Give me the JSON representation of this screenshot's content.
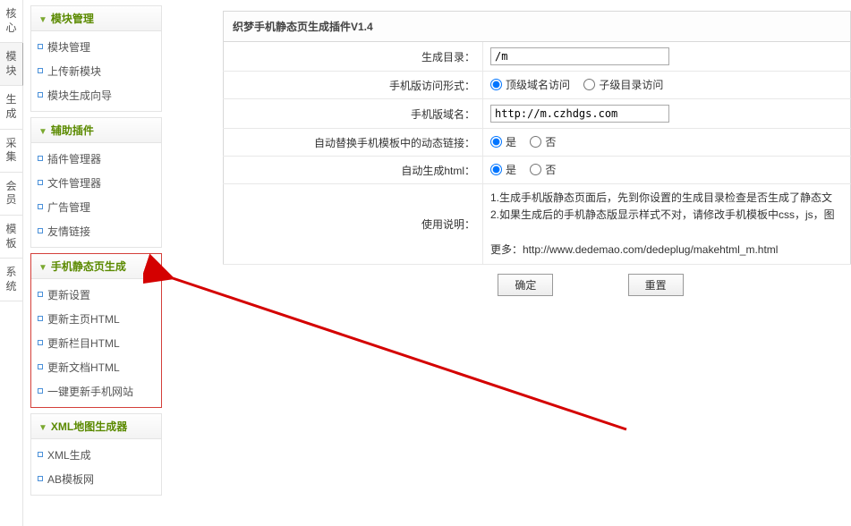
{
  "tabs": [
    "核心",
    "模块",
    "生成",
    "采集",
    "会员",
    "模板",
    "系统"
  ],
  "active_tab_index": 1,
  "sidebar": {
    "groups": [
      {
        "title": "模块管理",
        "highlight": false,
        "items": [
          "模块管理",
          "上传新模块",
          "模块生成向导"
        ]
      },
      {
        "title": "辅助插件",
        "highlight": false,
        "items": [
          "插件管理器",
          "文件管理器",
          "广告管理",
          "友情链接"
        ]
      },
      {
        "title": "手机静态页生成",
        "highlight": true,
        "items": [
          "更新设置",
          "更新主页HTML",
          "更新栏目HTML",
          "更新文档HTML",
          "一键更新手机网站"
        ]
      },
      {
        "title": "XML地图生成器",
        "highlight": false,
        "items": [
          "XML生成",
          "AB模板网"
        ]
      }
    ]
  },
  "panel": {
    "title": "织梦手机静态页生成插件V1.4",
    "fields": {
      "gen_dir": {
        "label": "生成目录：",
        "value": "/m"
      },
      "visit_mode": {
        "label": "手机版访问形式：",
        "opt1": "顶级域名访问",
        "opt2": "子级目录访问",
        "selected": 0
      },
      "domain": {
        "label": "手机版域名：",
        "value": "http://m.czhdgs.com"
      },
      "replace_links": {
        "label": "自动替换手机模板中的动态链接：",
        "opt1": "是",
        "opt2": "否",
        "selected": 0
      },
      "auto_html": {
        "label": "自动生成html：",
        "opt1": "是",
        "opt2": "否",
        "selected": 0
      },
      "desc": {
        "label": "使用说明：",
        "line1": "1.生成手机版静态页面后，先到你设置的生成目录检查是否生成了静态文",
        "line2": "2.如果生成后的手机静态版显示样式不对，请修改手机模板中css，js，图",
        "line3": "更多：http://www.dedemao.com/dedeplug/makehtml_m.html"
      }
    },
    "buttons": {
      "ok": "确定",
      "reset": "重置"
    }
  }
}
